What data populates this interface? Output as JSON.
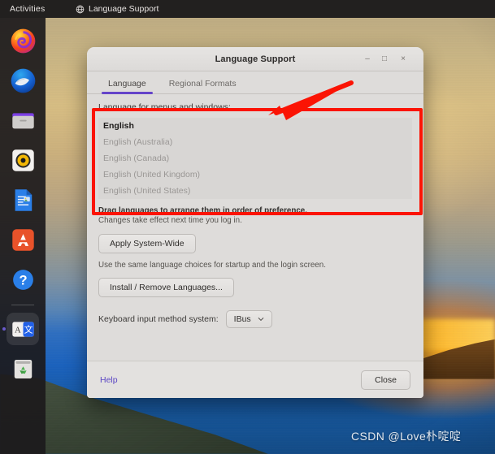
{
  "topbar": {
    "activities_label": "Activities",
    "app_name": "Language Support",
    "globe_icon": "globe-icon"
  },
  "dock": {
    "items": [
      {
        "name": "firefox",
        "label": "Firefox",
        "running": false
      },
      {
        "name": "thunderbird",
        "label": "Thunderbird Mail",
        "running": false
      },
      {
        "name": "files",
        "label": "Files",
        "running": false
      },
      {
        "name": "rhythmbox",
        "label": "Rhythmbox",
        "running": false
      },
      {
        "name": "libreoffice-writer",
        "label": "LibreOffice Writer",
        "running": false
      },
      {
        "name": "ubuntu-software",
        "label": "Ubuntu Software",
        "running": false
      },
      {
        "name": "help",
        "label": "Help",
        "running": false
      },
      {
        "name": "language-support",
        "label": "Language Support",
        "running": true
      },
      {
        "name": "trash",
        "label": "Trash",
        "running": false
      }
    ]
  },
  "window": {
    "title": "Language Support",
    "minimize_label": "–",
    "maximize_label": "□",
    "close_label": "×",
    "tabs": [
      {
        "label": "Language",
        "active": true
      },
      {
        "label": "Regional Formats",
        "active": false
      }
    ],
    "list_label": "Language for menus and windows:",
    "languages": [
      {
        "label": "English",
        "selected": true
      },
      {
        "label": "English (Australia)",
        "selected": false
      },
      {
        "label": "English (Canada)",
        "selected": false
      },
      {
        "label": "English (United Kingdom)",
        "selected": false
      },
      {
        "label": "English (United States)",
        "selected": false
      }
    ],
    "hint_strong": "Drag languages to arrange them in order of preference.",
    "hint_normal": "Changes take effect next time you log in.",
    "apply_button": "Apply System-Wide",
    "login_hint": "Use the same language choices for startup and the login screen.",
    "install_button": "Install / Remove Languages...",
    "ime_label": "Keyboard input method system:",
    "ime_value": "IBus",
    "ime_chevron_icon": "chevron-down-icon",
    "help_link": "Help",
    "close_button": "Close"
  },
  "annotations": {
    "box_color": "#fb1404",
    "arrow_color": "#fb1404",
    "arrow_icon": "arrow-pointer-icon"
  },
  "watermark": {
    "text": "CSDN @Love朴啶啶"
  }
}
